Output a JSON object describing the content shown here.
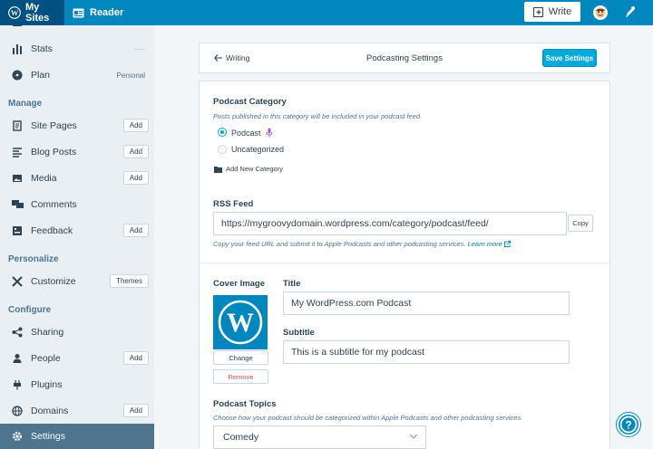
{
  "masterbar": {
    "my_sites": "My Sites",
    "reader": "Reader",
    "write": "Write"
  },
  "sidebar": {
    "top_items": [
      {
        "label": "Stats",
        "icon": "stats-icon"
      },
      {
        "label": "Plan",
        "icon": "plan-icon",
        "tag": "Personal"
      }
    ],
    "sections": [
      {
        "heading": "Manage",
        "items": [
          {
            "label": "Site Pages",
            "icon": "pages-icon",
            "button": "Add"
          },
          {
            "label": "Blog Posts",
            "icon": "posts-icon",
            "button": "Add"
          },
          {
            "label": "Media",
            "icon": "media-icon",
            "button": "Add"
          },
          {
            "label": "Comments",
            "icon": "comments-icon"
          },
          {
            "label": "Feedback",
            "icon": "feedback-icon",
            "button": "Add"
          }
        ]
      },
      {
        "heading": "Personalize",
        "items": [
          {
            "label": "Customize",
            "icon": "customize-icon",
            "button": "Themes"
          }
        ]
      },
      {
        "heading": "Configure",
        "items": [
          {
            "label": "Sharing",
            "icon": "sharing-icon"
          },
          {
            "label": "People",
            "icon": "people-icon",
            "button": "Add"
          },
          {
            "label": "Plugins",
            "icon": "plugins-icon"
          },
          {
            "label": "Domains",
            "icon": "domains-icon",
            "button": "Add"
          },
          {
            "label": "Settings",
            "icon": "settings-icon",
            "active": true
          }
        ]
      }
    ]
  },
  "header": {
    "back_label": "Writing",
    "title": "Podcasting Settings",
    "save_label": "Save Settings"
  },
  "category": {
    "label": "Podcast Category",
    "hint": "Posts published in this category will be included in your podcast feed.",
    "options": [
      {
        "label": "Podcast",
        "selected": true
      },
      {
        "label": "Uncategorized",
        "selected": false
      }
    ],
    "add_new": "Add New Category"
  },
  "rss": {
    "label": "RSS Feed",
    "url": "https://mygroovydomain.wordpress.com/category/podcast/feed/",
    "copy_label": "Copy",
    "hint": "Copy your feed URL and submit it to Apple Podcasts and other podcasting services.",
    "learn_more": "Learn more"
  },
  "cover": {
    "label": "Cover Image",
    "change_label": "Change",
    "remove_label": "Remove"
  },
  "title_field": {
    "label": "Title",
    "value": "My WordPress.com Podcast"
  },
  "subtitle_field": {
    "label": "Subtitle",
    "value": "This is a subtitle for my podcast"
  },
  "topics": {
    "label": "Podcast Topics",
    "hint": "Choose how your podcast should be categorized within Apple Podcasts and other podcasting services.",
    "selected": "Comedy"
  },
  "colors": {
    "masterbar": "#0087be",
    "accent": "#00aadc",
    "sidebar_active": "#4f748e"
  }
}
